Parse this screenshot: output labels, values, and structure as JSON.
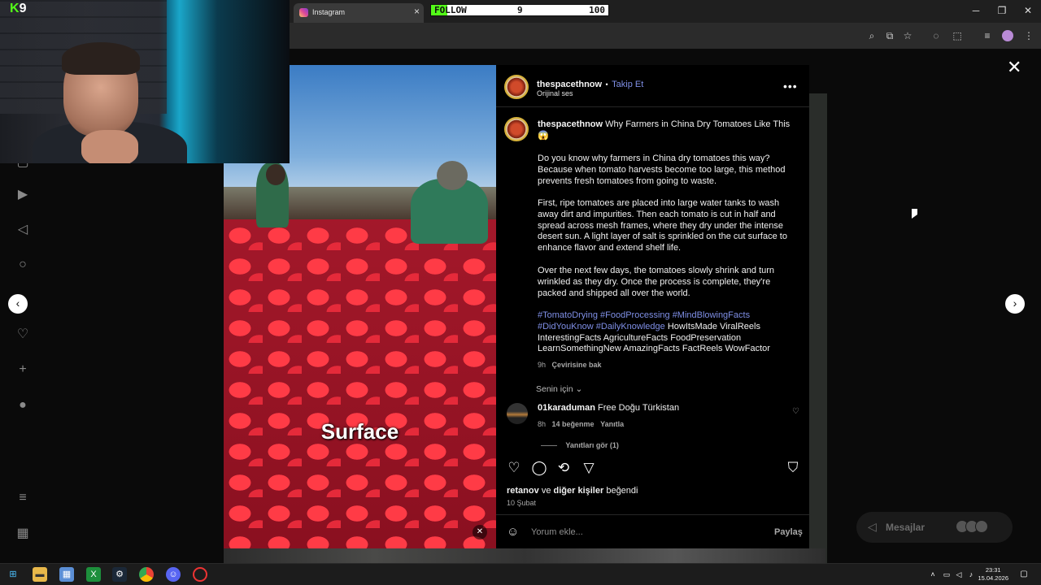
{
  "stream_overlay": {
    "logo_k": "K",
    "logo_num": "9",
    "follow_goal": {
      "label": "FOLLOW",
      "current": "9",
      "goal": "100",
      "progress": 0.09,
      "color": "#53fc18"
    }
  },
  "browser": {
    "tab_title": "Instagram",
    "tab_close": "×"
  },
  "sidebar_icons": [
    "reels-icon",
    "explore-icon",
    "search-icon",
    "notifications-icon",
    "create-icon",
    "profile-icon",
    "menu-icon",
    "more-icon"
  ],
  "post": {
    "header": {
      "username": "thespacethnow",
      "dot": "•",
      "follow_label": "Takip Et",
      "audio": "Orijinal ses"
    },
    "caption": {
      "username": "thespacethnow",
      "title": "Why Farmers in China Dry Tomatoes Like This",
      "emoji": "😱",
      "p1": "Do you know why farmers in China dry tomatoes this way? Because when tomato harvests become too large, this method prevents fresh tomatoes from going to waste.",
      "p2": "First, ripe tomatoes are placed into large water tanks to wash away dirt and impurities. Then each tomato is cut in half and spread across mesh frames, where they dry under the intense desert sun. A light layer of salt is sprinkled on the cut surface to enhance flavor and extend shelf life.",
      "p3": "Over the next few days, the tomatoes slowly shrink and turn wrinkled as they dry. Once the process is complete, they're packed and shipped all over the world.",
      "hashtags_line1": "#TomatoDrying #FoodProcessing #MindBlowingFacts",
      "hashtags_line2_tags": "#DidYouKnow #DailyKnowledge",
      "hashtags_line2_plain": "HowItsMade ViralReels",
      "plain_line3": "InterestingFacts AgricultureFacts FoodPreservation",
      "plain_line4": "LearnSomethingNew AmazingFacts FactReels WowFactor",
      "time": "9h",
      "translate": "Çevirisine bak"
    },
    "for_you": "Senin için",
    "comment": {
      "username": "01karaduman",
      "text": "Free Doğu Türkistan",
      "time": "8h",
      "likes": "14 beğenme",
      "reply": "Yanıtla",
      "view_replies": "Yanıtları gör (1)"
    },
    "likes_line_user": "retanov",
    "likes_line_mid": "ve",
    "likes_line_others": "diğer kişiler",
    "likes_line_end": "beğendi",
    "date": "10 Şubat",
    "comment_placeholder": "Yorum ekle...",
    "share_label": "Paylaş",
    "video_caption": "Surface"
  },
  "messages": {
    "label": "Mesajlar"
  },
  "taskbar": {
    "time": "23:31",
    "date": "15.04.2026"
  }
}
